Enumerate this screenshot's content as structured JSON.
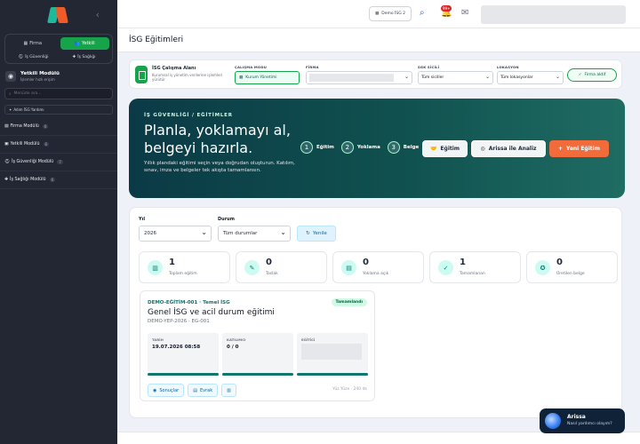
{
  "sidebar": {
    "mode_tabs": [
      {
        "label": "Firma"
      },
      {
        "label": "Yetkili"
      }
    ],
    "sub_tabs": [
      {
        "label": "İş Güvenliği"
      },
      {
        "label": "İş Sağlığı"
      }
    ],
    "module_title": "Yetkili Modülü",
    "module_subtitle": "İşlemler hızlı erişim",
    "search_placeholder": "Menüde ara...",
    "adim_label": "Adım İSG Yardımı",
    "nav_items": [
      {
        "label": "Firma Modülü",
        "count": "6"
      },
      {
        "label": "Yetkili Modülü",
        "count": "6"
      },
      {
        "label": "İş Güvenliği Modülü",
        "count": "7"
      },
      {
        "label": "İş Sağlığı Modülü",
        "count": "6"
      }
    ]
  },
  "topbar": {
    "demo_label": "Demo İSG 2",
    "notif_count": "99+"
  },
  "page_title": "İSG Eğitimleri",
  "filter": {
    "title": "İSG Çalışma Alanı",
    "description": "Kurumsal iş yönetim verilerine işlemleri yürütür",
    "mode_label": "ÇALIŞMA MODU",
    "mode_value": "Kurum Yönetimi",
    "firm_label": "FİRMA",
    "sgk_label": "SGK SİCİLİ",
    "sgk_value": "Tüm siciller",
    "location_label": "LOKASYON",
    "location_value": "Tüm lokasyonlar",
    "firm_button": "Firma aktif"
  },
  "hero": {
    "eyebrow": "İŞ GÜVENLİĞİ / EĞİTİMLER",
    "title": "Planla, yoklamayı al, belgeyi hazırla.",
    "description": "Yıllık plandaki eğitimi seçin veya doğrudan oluşturun. Katılım, sınav, imza ve belgeler tek akışta tamamlansın.",
    "steps": [
      {
        "n": "1",
        "label": "Eğitim"
      },
      {
        "n": "2",
        "label": "Yoklama"
      },
      {
        "n": "3",
        "label": "Belge"
      }
    ],
    "buttons": {
      "egitim": "Eğitim",
      "analiz": "Arissa ile Analiz",
      "yeni": "Yeni Eğitim"
    }
  },
  "filters": {
    "year_label": "Yıl",
    "year_value": "2026",
    "status_label": "Durum",
    "status_value": "Tüm durumlar",
    "refresh": "Yenile"
  },
  "stats": [
    {
      "value": "1",
      "label": "Toplam eğitim"
    },
    {
      "value": "0",
      "label": "Taslak"
    },
    {
      "value": "0",
      "label": "Yoklama açık"
    },
    {
      "value": "1",
      "label": "Tamamlanan"
    },
    {
      "value": "0",
      "label": "Üretilen belge"
    }
  ],
  "training": {
    "code": "DEMO-EĞİTİM-001 · Temel İSG",
    "status": "Tamamlandı",
    "title": "Genel İSG ve acil durum eğitimi",
    "subtitle": "DEMO-YEP-2026 · EG-001",
    "date_label": "TARİH",
    "date_value": "19.07.2026 08:58",
    "participant_label": "KATILIMCI",
    "participant_value": "0 / 0",
    "trainer_label": "EĞİTİCİ",
    "actions": {
      "results": "Sonuçlar",
      "docs": "Evrak"
    },
    "meta": "Yüz Yüze · 240 dk"
  },
  "assistant": {
    "title": "Arissa",
    "subtitle": "Nasıl yardımcı olayım?"
  }
}
